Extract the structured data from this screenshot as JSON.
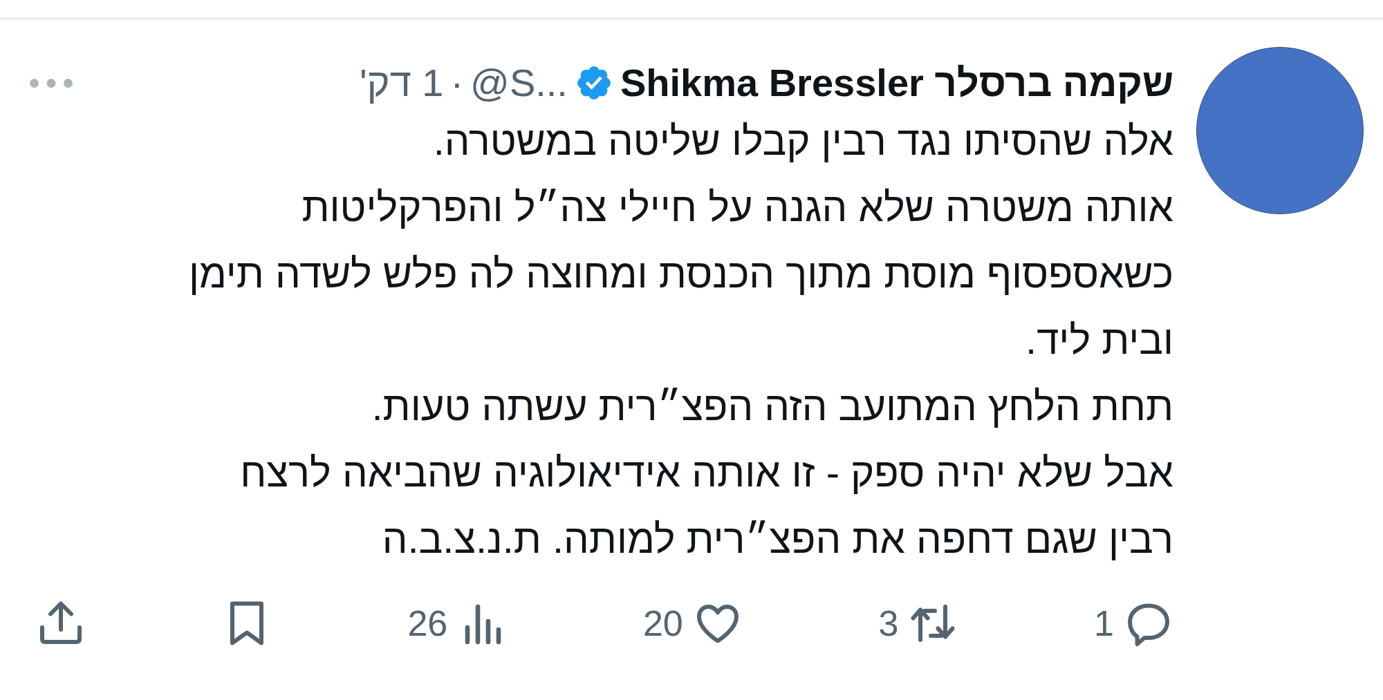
{
  "author": {
    "name": "שקמה ברסלר Shikma Bressler",
    "verified": true,
    "handle": "@S...",
    "separator": "·",
    "time": "1 דק'"
  },
  "lines": [
    "אלה שהסיתו נגד רבין קבלו שליטה במשטרה.",
    "אותה משטרה שלא הגנה על חיילי צה״ל והפרקליטות",
    "כשאספסוף מוסת מתוך הכנסת ומחוצה לה פלש לשדה תימן",
    "ובית ליד.",
    "תחת הלחץ המתועב הזה הפצ״רית עשתה טעות.",
    "אבל שלא יהיה ספק - זו אותה אידיאולוגיה שהביאה לרצח",
    "רבין שגם דחפה את הפצ״רית למותה. ת.נ.צ.ב.ה"
  ],
  "actions": [
    {
      "kind": "reply",
      "count": "1"
    },
    {
      "kind": "retweet",
      "count": "3"
    },
    {
      "kind": "like",
      "count": "20"
    },
    {
      "kind": "views",
      "count": "26"
    },
    {
      "kind": "bookmark"
    },
    {
      "kind": "share"
    }
  ]
}
